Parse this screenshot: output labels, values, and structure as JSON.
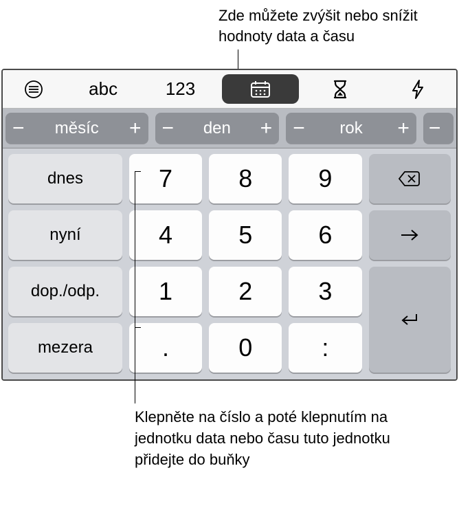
{
  "callouts": {
    "top": "Zde můžete zvýšit nebo snížit hodnoty data a času",
    "bottom": "Klepněte na číslo a poté klepnutím na jednotku data nebo času tuto jednotku přidejte do buňky"
  },
  "mode_row": {
    "abc": "abc",
    "num": "123"
  },
  "units": {
    "month": "měsíc",
    "day": "den",
    "year": "rok",
    "minus": "−",
    "plus": "+"
  },
  "side_keys": {
    "today": "dnes",
    "now": "nyní",
    "am_pm": "dop./odp.",
    "space": "mezera"
  },
  "numpad": {
    "r1": [
      "7",
      "8",
      "9"
    ],
    "r2": [
      "4",
      "5",
      "6"
    ],
    "r3": [
      "1",
      "2",
      "3"
    ],
    "r4": [
      ".",
      "0",
      ":"
    ]
  }
}
